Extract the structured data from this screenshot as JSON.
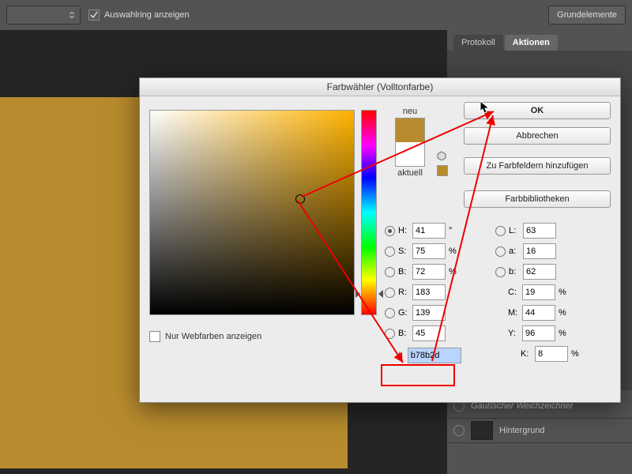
{
  "toolbar": {
    "checkbox_label": "Auswahlring anzeigen",
    "right_button": "Grundelemente"
  },
  "panel": {
    "tab_protocol": "Protokoll",
    "tab_actions": "Aktionen",
    "layer_gauss": "Gaußscher Weichzeichner",
    "layer_bg": "Hintergrund"
  },
  "dialog": {
    "title": "Farbwähler (Volltonfarbe)",
    "ok": "OK",
    "cancel": "Abbrechen",
    "add_swatch": "Zu Farbfeldern hinzufügen",
    "libraries": "Farbbibliotheken",
    "label_new": "neu",
    "label_current": "aktuell",
    "webonly": "Nur Webfarben anzeigen",
    "H": "41",
    "S": "75",
    "Bv": "72",
    "R": "183",
    "G": "139",
    "Bc": "45",
    "L": "63",
    "a": "16",
    "b": "62",
    "C": "19",
    "M": "44",
    "Y": "96",
    "K": "8",
    "hex": "b78b2d",
    "lbl_H": "H:",
    "lbl_S": "S:",
    "lbl_Bv": "B:",
    "lbl_R": "R:",
    "lbl_G": "G:",
    "lbl_Bc": "B:",
    "lbl_L": "L:",
    "lbl_a": "a:",
    "lbl_b": "b:",
    "lbl_C": "C:",
    "lbl_M": "M:",
    "lbl_Y": "Y:",
    "lbl_K": "K:",
    "unit_deg": "°",
    "unit_pct": "%",
    "hash": "#"
  }
}
